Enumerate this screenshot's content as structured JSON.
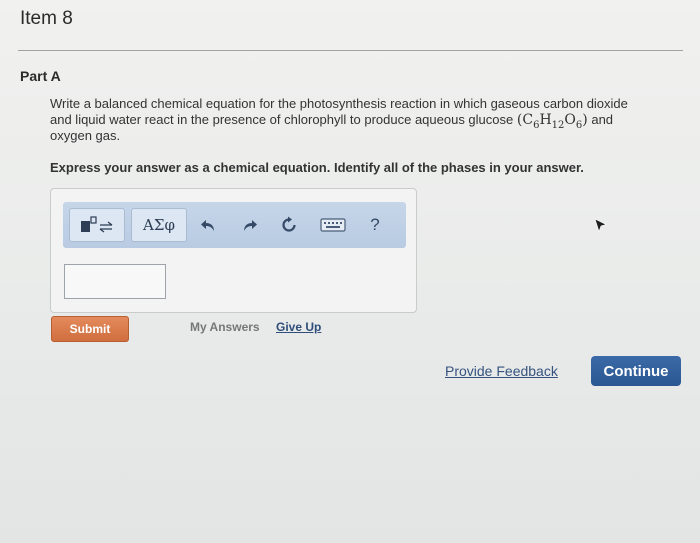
{
  "item": {
    "title": "Item 8"
  },
  "part": {
    "title": "Part A"
  },
  "question": {
    "text": "Write a balanced chemical equation for the photosynthesis reaction in which gaseous carbon dioxide and liquid water react in the presence of chlorophyll to produce aqueous glucose",
    "formula": {
      "c": "C",
      "c_sub": "6",
      "h": "H",
      "h_sub": "12",
      "o": "O",
      "o_sub": "6"
    },
    "text_after": "and oxygen gas.",
    "instruction": "Express your answer as a chemical equation. Identify all of the phases in your answer."
  },
  "toolbar": {
    "templates_icon": "templates-icon",
    "greek_label": "ΑΣφ",
    "undo_icon": "undo-icon",
    "redo_icon": "redo-icon",
    "reset_icon": "reset-icon",
    "keyboard_icon": "keyboard-icon",
    "help_label": "?"
  },
  "answer": {
    "value": ""
  },
  "actions": {
    "submit_label": "Submit",
    "my_answers_label": "My Answers",
    "give_up_label": "Give Up"
  },
  "footer": {
    "feedback_label": "Provide Feedback",
    "continue_label": "Continue"
  },
  "colors": {
    "submit": "#d87a4a",
    "continue": "#2f5f9e",
    "toolbar": "#bfd0e6",
    "link": "#36537f"
  }
}
